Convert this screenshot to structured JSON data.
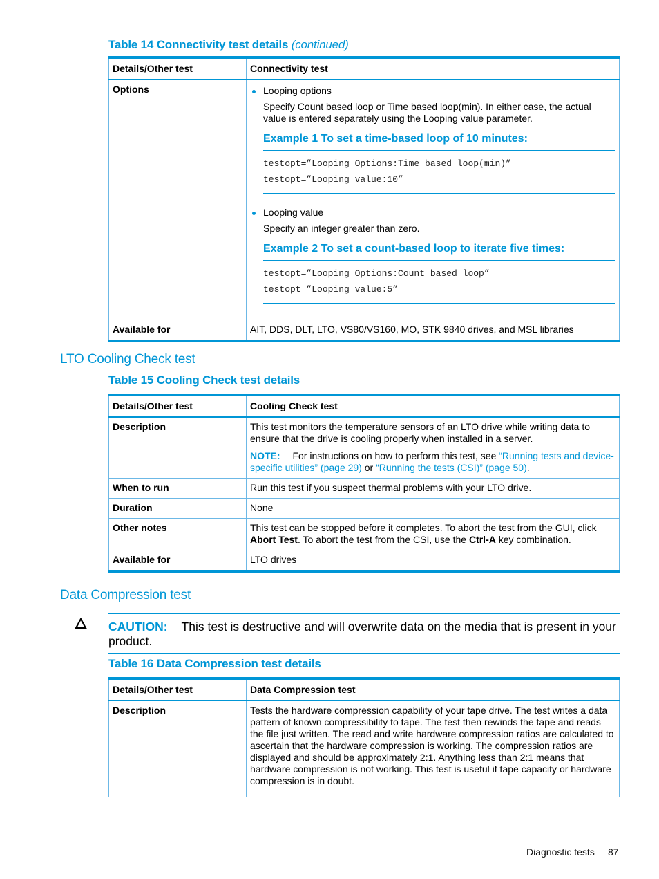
{
  "table14": {
    "caption": "Table 14 Connectivity test details",
    "caption_suffix": "(continued)",
    "headers": [
      "Details/Other test",
      "Connectivity test"
    ],
    "options_label": "Options",
    "bullet1": "Looping options",
    "bullet1_text": "Specify Count based loop or Time based loop(min). In either case, the actual value is entered separately using the Looping value parameter.",
    "example1_title": "Example 1 To set a time-based loop of 10 minutes:",
    "example1_code": [
      "testopt=”Looping Options:Time based loop(min)”",
      "testopt=”Looping value:10”"
    ],
    "bullet2": "Looping value",
    "bullet2_text": "Specify an integer greater than zero.",
    "example2_title": "Example 2 To set a count-based loop to iterate five times:",
    "example2_code": [
      "testopt=”Looping Options:Count based loop”",
      "testopt=”Looping value:5”"
    ],
    "available_label": "Available for",
    "available_value": "AIT, DDS, DLT, LTO, VS80/VS160, MO, STK 9840 drives, and MSL libraries"
  },
  "section_lto": {
    "heading": "LTO Cooling Check test"
  },
  "table15": {
    "caption": "Table 15 Cooling Check test details",
    "headers": [
      "Details/Other test",
      "Cooling Check test"
    ],
    "description_label": "Description",
    "description_text": "This test monitors the temperature sensors of an LTO drive while writing data to ensure that the drive is cooling properly when installed in a server.",
    "note_label": "NOTE:",
    "note_prefix": "For instructions on how to perform this test, see",
    "note_link1": "“Running tests and device-specific utilities” (page 29)",
    "note_or": "or",
    "note_link2": "“Running the tests (CSI)” (page 50)",
    "note_end": ".",
    "when_label": "When to run",
    "when_value": "Run this test if you suspect thermal problems with your LTO drive.",
    "duration_label": "Duration",
    "duration_value": "None",
    "other_label": "Other notes",
    "other_part1": "This test can be stopped before it completes. To abort the test from the GUI, click",
    "other_bold1": "Abort Test",
    "other_part2": ". To abort the test from the CSI, use the",
    "other_bold2": "Ctrl-A",
    "other_part3": "key combination.",
    "available_label": "Available for",
    "available_value": "LTO drives"
  },
  "section_dc": {
    "heading": "Data Compression test"
  },
  "caution": {
    "icon": "caution-triangle-icon",
    "label": "CAUTION:",
    "text": "This test is destructive and will overwrite data on the media that is present in your product."
  },
  "table16": {
    "caption": "Table 16 Data Compression test details",
    "headers": [
      "Details/Other test",
      "Data Compression test"
    ],
    "description_label": "Description",
    "description_text": "Tests the hardware compression capability of your tape drive. The test writes a data pattern of known compressibility to tape. The test then rewinds the tape and reads the file just written. The read and write hardware compression ratios are calculated to ascertain that the hardware compression is working. The compression ratios are displayed and should be approximately 2:1. Anything less than 2:1 means that hardware compression is not working. This test is useful if tape capacity or hardware compression is in doubt."
  },
  "footer": {
    "section": "Diagnostic tests",
    "page": "87"
  }
}
